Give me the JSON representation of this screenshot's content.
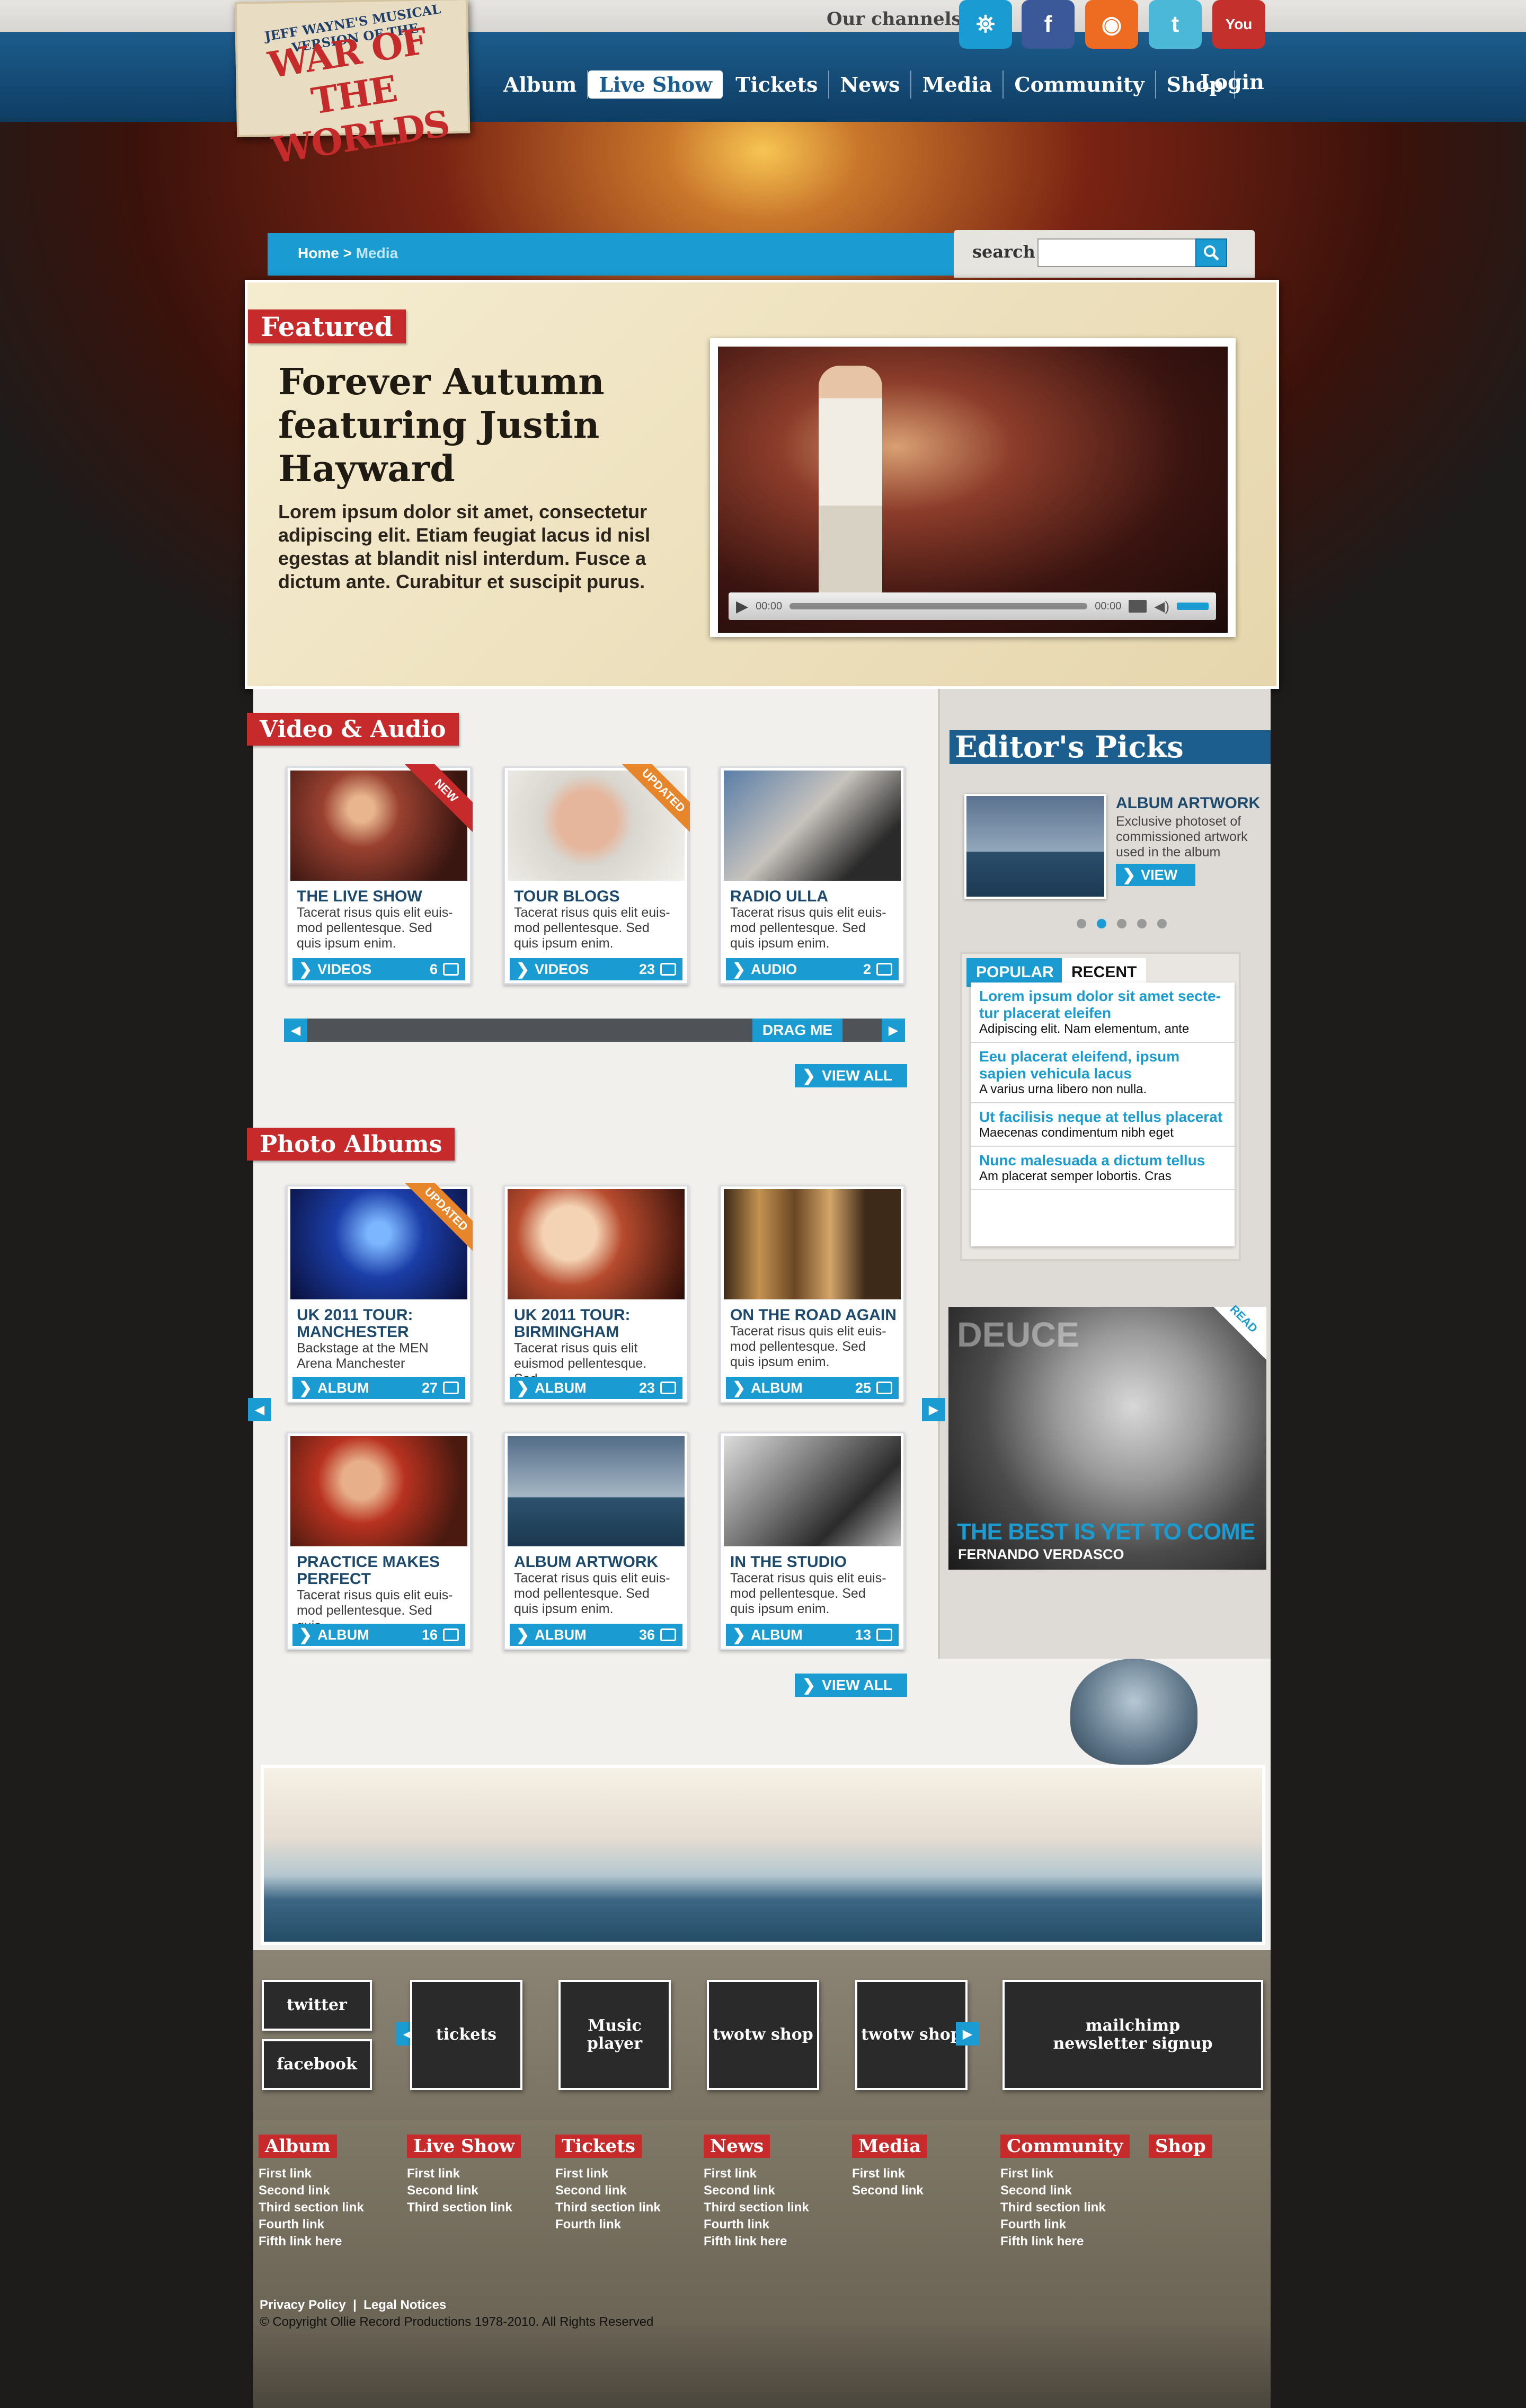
{
  "header": {
    "logo_text": "WAR OF THE WORLDS",
    "logo_sub": "JEFF WAYNE'S MUSICAL VERSION OF THE",
    "channels_label": "Our channels:",
    "channels": [
      {
        "icon": "tripod-icon",
        "glyph": "⛯",
        "color": "#1a9bd1"
      },
      {
        "icon": "facebook-icon",
        "glyph": "f",
        "color": "#3b5998"
      },
      {
        "icon": "rss-icon",
        "glyph": "◉",
        "color": "#ee6c22"
      },
      {
        "icon": "twitter-icon",
        "glyph": "t",
        "color": "#4bb8d8"
      },
      {
        "icon": "youtube-icon",
        "glyph": "You",
        "color": "#c4302b"
      }
    ],
    "nav": [
      "Album",
      "Live Show",
      "Tickets",
      "News",
      "Media",
      "Community",
      "Shop"
    ],
    "nav_active": "Live Show",
    "login": "Login"
  },
  "breadcrumb": {
    "home": "Home",
    "sep": " > ",
    "current": "Media"
  },
  "search": {
    "label": "search",
    "placeholder": ""
  },
  "featured": {
    "label": "Featured",
    "title": "Forever Autumn featuring Justin Hayward",
    "description": "Lorem ipsum dolor sit amet, consectetur adipiscing elit. Etiam feugiat lacus id nisl egestas at blandit nisl interdum. Fusce a dictum ante. Curabitur et suscipit purus.",
    "player": {
      "time_elapsed": "00:00",
      "time_total": "00:00"
    }
  },
  "video_audio": {
    "label": "Video & Audio",
    "items": [
      {
        "title": "THE LIVE SHOW",
        "desc": "Tacerat risus quis elit euis-mod pellentesque. Sed quis ipsum enim.",
        "button": "VIDEOS",
        "count": "6",
        "badge": "NEW",
        "badge_color": "red",
        "thumb": "stage"
      },
      {
        "title": "TOUR BLOGS",
        "desc": "Tacerat risus quis elit euis-mod pellentesque. Sed quis ipsum enim.",
        "button": "VIDEOS",
        "count": "23",
        "badge": "UPDATED",
        "badge_color": "orange",
        "thumb": "blog"
      },
      {
        "title": "RADIO ULLA",
        "desc": "Tacerat risus quis elit euis-mod pellentesque. Sed quis ipsum enim.",
        "button": "AUDIO",
        "count": "2",
        "badge": "",
        "badge_color": "",
        "thumb": "radio"
      }
    ],
    "drag_label": "DRAG ME",
    "view_all": "VIEW ALL"
  },
  "photo_albums": {
    "label": "Photo Albums",
    "items": [
      {
        "title": "UK 2011 TOUR: MANCHESTER",
        "desc": "Backstage at the MEN Arena Manchester",
        "button": "ALBUM",
        "count": "27",
        "badge": "UPDATED",
        "thumb": "concert"
      },
      {
        "title": "UK 2011 TOUR: BIRMINGHAM",
        "desc": "Tacerat risus quis elit euismod pellentesque. Sed",
        "button": "ALBUM",
        "count": "23",
        "badge": "",
        "thumb": "actors"
      },
      {
        "title": "ON THE ROAD AGAIN",
        "desc": "Tacerat risus quis elit euis-mod pellentesque. Sed quis ipsum enim.",
        "button": "ALBUM",
        "count": "25",
        "badge": "",
        "thumb": "guitars"
      },
      {
        "title": "PRACTICE MAKES PERFECT",
        "desc": "Tacerat risus quis elit euis-mod pellentesque. Sed quis",
        "button": "ALBUM",
        "count": "16",
        "badge": "",
        "thumb": "bass"
      },
      {
        "title": "ALBUM ARTWORK",
        "desc": "Tacerat risus quis elit euis-mod pellentesque. Sed quis ipsum enim.",
        "button": "ALBUM",
        "count": "36",
        "badge": "",
        "thumb": "artwork"
      },
      {
        "title": "IN THE STUDIO",
        "desc": "Tacerat risus quis elit euis-mod pellentesque. Sed quis ipsum enim.",
        "button": "ALBUM",
        "count": "13",
        "badge": "",
        "thumb": "studio"
      }
    ],
    "view_all": "VIEW ALL"
  },
  "editors_picks": {
    "label": "Editor's Picks",
    "pick": {
      "title": "ALBUM ARTWORK",
      "desc": "Exclusive photoset of commissioned artwork used in the album",
      "button": "VIEW"
    },
    "dots_total": 5,
    "dots_active": 1
  },
  "tabs": {
    "items": [
      "POPULAR",
      "RECENT"
    ],
    "active": "RECENT",
    "list": [
      {
        "title": "Lorem ipsum dolor sit amet secte-tur placerat eleifen",
        "sub": "Adipiscing elit. Nam elementum, ante"
      },
      {
        "title": "Eeu placerat eleifend, ipsum sapien vehicula lacus",
        "sub": "A varius urna libero non nulla."
      },
      {
        "title": "Ut facilisis neque at tellus placerat",
        "sub": "Maecenas condimentum nibh eget"
      },
      {
        "title": "Nunc malesuada a dictum tellus",
        "sub": "Am placerat semper lobortis. Cras"
      }
    ]
  },
  "promo": {
    "brand": "DEUCE",
    "corner": "READ",
    "title": "THE BEST IS YET TO COME",
    "subtitle": "FERNANDO VERDASCO"
  },
  "footer": {
    "social": [
      "twitter",
      "facebook"
    ],
    "boxes": [
      "tickets",
      "Music player",
      "twotw shop",
      "twotw shop"
    ],
    "newsletter": "mailchimp newsletter signup",
    "columns": [
      {
        "head": "Album",
        "links": [
          "First link",
          "Second link",
          "Third section link",
          "Fourth link",
          "Fifth link here"
        ]
      },
      {
        "head": "Live Show",
        "links": [
          "First link",
          "Second link",
          "Third section link"
        ]
      },
      {
        "head": "Tickets",
        "links": [
          "First link",
          "Second link",
          "Third section link",
          "Fourth link"
        ]
      },
      {
        "head": "News",
        "links": [
          "First link",
          "Second link",
          "Third section link",
          "Fourth link",
          "Fifth link here"
        ]
      },
      {
        "head": "Media",
        "links": [
          "First link",
          "Second link"
        ]
      },
      {
        "head": "Community",
        "links": [
          "First link",
          "Second link",
          "Third section link",
          "Fourth link",
          "Fifth link here"
        ]
      },
      {
        "head": "Shop",
        "links": []
      }
    ],
    "legal": [
      "Privacy Policy",
      "Legal Notices"
    ],
    "copyright": "© Copyright Ollie Record Productions 1978-2010. All Rights Reserved"
  },
  "colors": {
    "accent_blue": "#1a9bd1",
    "ribbon_red": "#c62a2a",
    "nav_blue": "#1c5c8c",
    "badge_orange": "#e7852a"
  }
}
